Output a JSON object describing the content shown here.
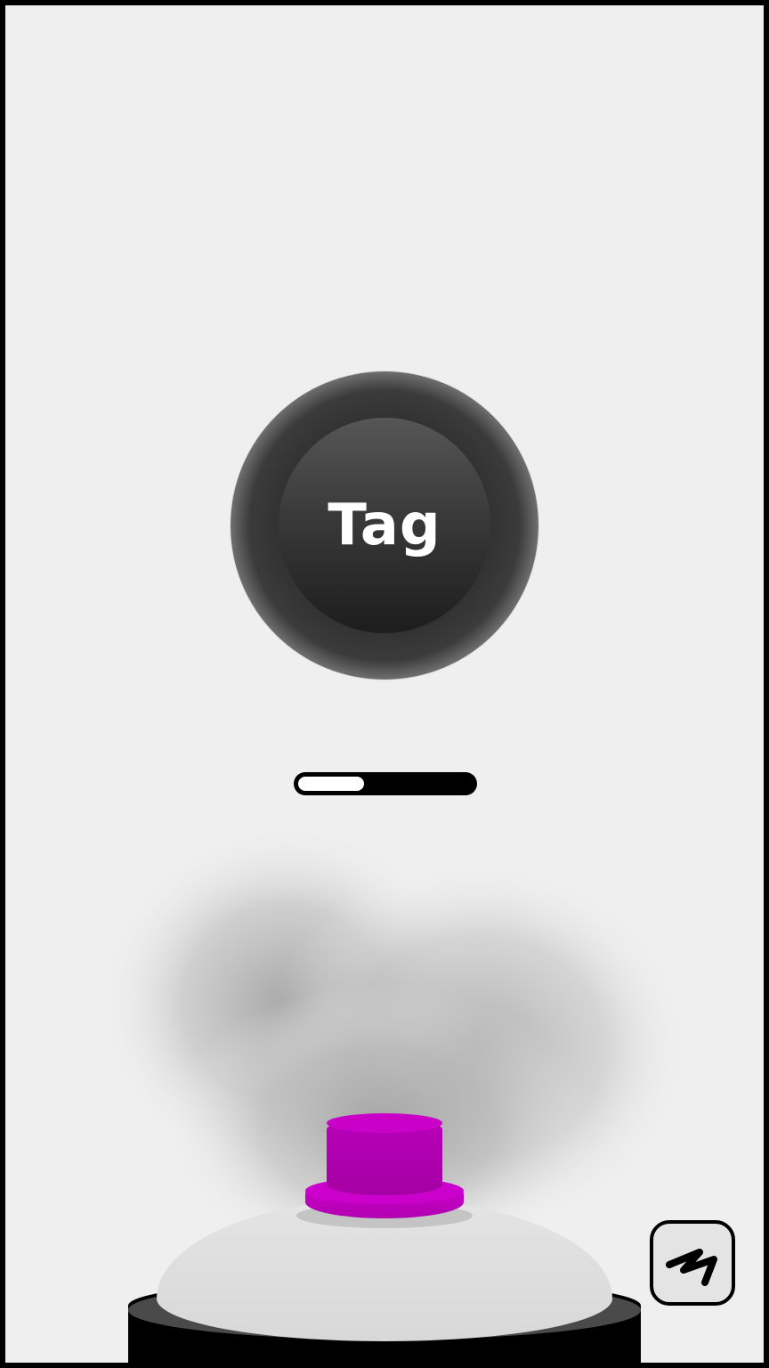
{
  "tag_button": {
    "label": "Tag"
  },
  "spray_level": {
    "fraction": 0.38
  },
  "spray_can": {
    "nozzle_color": "#c000c0",
    "cap_color": "#000000",
    "dome_color": "#dcdcdc"
  },
  "toolbar": {
    "scribble_icon": "scribble-icon"
  },
  "colors": {
    "background": "#efefef",
    "frame": "#000000",
    "accent": "#c000c0"
  }
}
